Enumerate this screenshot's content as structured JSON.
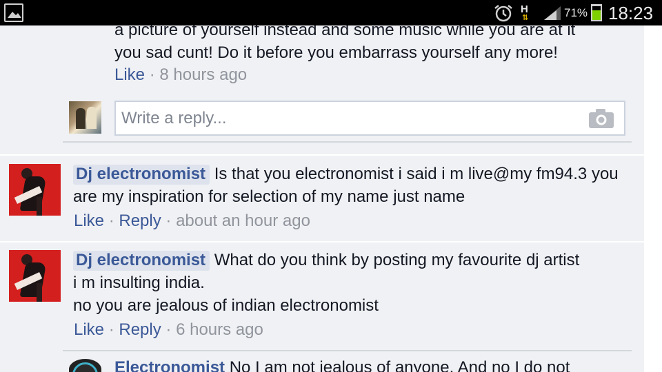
{
  "status_bar": {
    "battery_percent": "71%",
    "battery_level": 0.71,
    "network": "H",
    "time": "18:23",
    "icons": [
      "gallery-icon",
      "alarm-icon",
      "network-h-icon",
      "signal-icon",
      "battery-icon"
    ]
  },
  "thread": {
    "top_comment": {
      "text_line1": "a picture of yourself instead and some music while you are at it",
      "text_line2": "you sad cunt! Do it before you embarrass yourself any more!",
      "like": "Like",
      "sep": "·",
      "time": "8 hours ago"
    },
    "reply_box": {
      "placeholder": "Write a reply...",
      "camera_icon": "camera-icon"
    },
    "comments": [
      {
        "author": "Dj electronomist",
        "text": "Is that you electronomist i said i m live@my fm94.3 you are my inspiration for selection of my name just name",
        "like": "Like",
        "reply": "Reply",
        "sep": "·",
        "time": "about an hour ago"
      },
      {
        "author": "Dj electronomist",
        "text_line1": "What do you think by posting my favourite dj artist i m insulting india.",
        "text_line2": "no you are jealous of indian electronomist",
        "like": "Like",
        "reply": "Reply",
        "sep": "·",
        "time": "6 hours ago"
      }
    ],
    "nested_reply": {
      "author": "Electronomist",
      "text": "No I am not jealous of anyone. And no I do not"
    }
  },
  "colors": {
    "link": "#3b5998",
    "text": "#141823",
    "meta": "#90949c",
    "background": "#f0f1f4",
    "status_bar": "#000000"
  }
}
